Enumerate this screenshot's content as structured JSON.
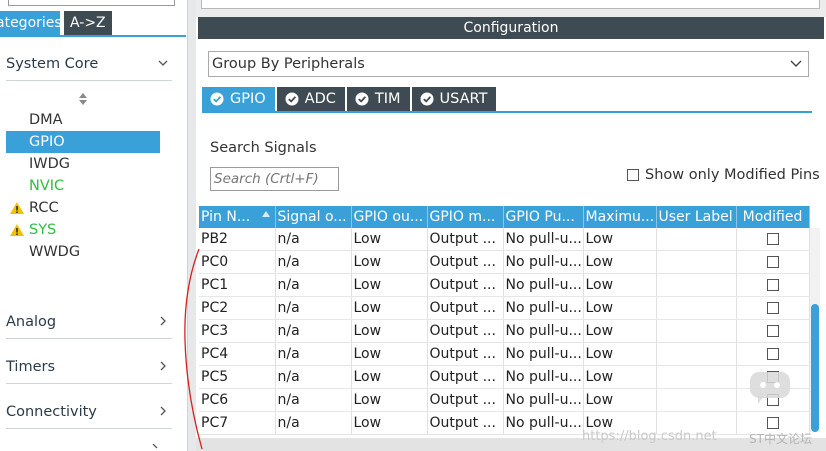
{
  "left_panel": {
    "tabs": {
      "categories": "ategories",
      "a_to_z": "A->Z"
    },
    "categories": [
      {
        "label": "System Core",
        "expanded": true
      },
      {
        "label": "Analog",
        "expanded": false
      },
      {
        "label": "Timers",
        "expanded": false
      },
      {
        "label": "Connectivity",
        "expanded": false
      }
    ],
    "system_core_items": [
      {
        "label": "DMA",
        "state": "normal"
      },
      {
        "label": "GPIO",
        "state": "selected"
      },
      {
        "label": "IWDG",
        "state": "normal"
      },
      {
        "label": "NVIC",
        "state": "green"
      },
      {
        "label": "RCC",
        "state": "warning"
      },
      {
        "label": "SYS",
        "state": "warning-green"
      },
      {
        "label": "WWDG",
        "state": "normal"
      }
    ]
  },
  "config": {
    "header": "Configuration",
    "group_select": "Group By Peripherals",
    "peripheral_tabs": [
      {
        "label": "GPIO",
        "active": true
      },
      {
        "label": "ADC",
        "active": false
      },
      {
        "label": "TIM",
        "active": false
      },
      {
        "label": "USART",
        "active": false
      }
    ],
    "search_label": "Search Signals",
    "search_placeholder": "Search (Crtl+F)",
    "show_modified_label": "Show only Modified Pins",
    "show_modified_checked": false
  },
  "table": {
    "columns": [
      "Pin N...",
      "Signal o...",
      "GPIO ou...",
      "GPIO m...",
      "GPIO Pu...",
      "Maximu...",
      "User Label",
      "Modified"
    ],
    "rows": [
      {
        "pin": "PB2",
        "signal": "n/a",
        "output": "Low",
        "mode": "Output ...",
        "pull": "No pull-u...",
        "max": "Low",
        "label": "",
        "modified": false
      },
      {
        "pin": "PC0",
        "signal": "n/a",
        "output": "Low",
        "mode": "Output ...",
        "pull": "No pull-u...",
        "max": "Low",
        "label": "",
        "modified": false
      },
      {
        "pin": "PC1",
        "signal": "n/a",
        "output": "Low",
        "mode": "Output ...",
        "pull": "No pull-u...",
        "max": "Low",
        "label": "",
        "modified": false
      },
      {
        "pin": "PC2",
        "signal": "n/a",
        "output": "Low",
        "mode": "Output ...",
        "pull": "No pull-u...",
        "max": "Low",
        "label": "",
        "modified": false
      },
      {
        "pin": "PC3",
        "signal": "n/a",
        "output": "Low",
        "mode": "Output ...",
        "pull": "No pull-u...",
        "max": "Low",
        "label": "",
        "modified": false
      },
      {
        "pin": "PC4",
        "signal": "n/a",
        "output": "Low",
        "mode": "Output ...",
        "pull": "No pull-u...",
        "max": "Low",
        "label": "",
        "modified": false
      },
      {
        "pin": "PC5",
        "signal": "n/a",
        "output": "Low",
        "mode": "Output ...",
        "pull": "No pull-u...",
        "max": "Low",
        "label": "",
        "modified": false
      },
      {
        "pin": "PC6",
        "signal": "n/a",
        "output": "Low",
        "mode": "Output ...",
        "pull": "No pull-u...",
        "max": "Low",
        "label": "",
        "modified": false
      },
      {
        "pin": "PC7",
        "signal": "n/a",
        "output": "Low",
        "mode": "Output ...",
        "pull": "No pull-u...",
        "max": "Low",
        "label": "",
        "modified": false
      }
    ]
  },
  "watermark": {
    "url": "https://blog.csdn.net",
    "forum": "ST中文论坛"
  },
  "colors": {
    "accent": "#3aa0d8",
    "dark_header": "#3f4b52",
    "green": "#2fbd3e",
    "warning": "#f2c200",
    "annotation": "#d42020"
  }
}
